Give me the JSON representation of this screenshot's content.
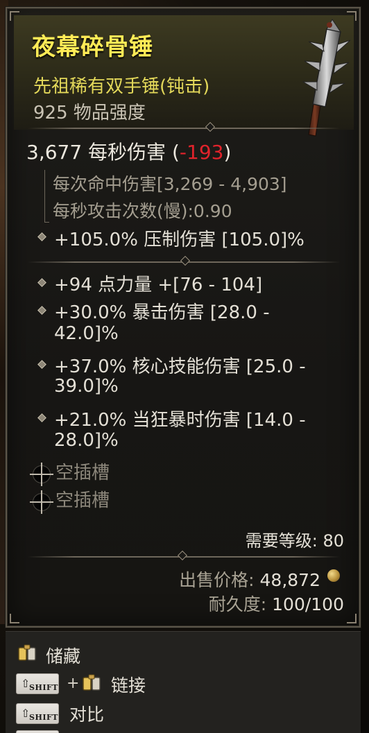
{
  "item": {
    "name": "夜幕碎骨锤",
    "type": "先祖稀有双手锤(钝击)",
    "power": "925 物品强度"
  },
  "stats": {
    "dps_value": "3,677 每秒伤害",
    "dps_delta_open": "(",
    "dps_delta": "-193",
    "dps_delta_close": ")",
    "damage_per_hit": "每次命中伤害[3,269 - 4,903]",
    "attack_speed": "每秒攻击次数(慢):0.90",
    "implicit": "+105.0% 压制伤害 [105.0]%"
  },
  "affixes": [
    {
      "line1": "+94 点力量 +[76 - 104]",
      "line2": ""
    },
    {
      "line1": "+30.0% 暴击伤害 [28.0 -",
      "line2": "42.0]%"
    },
    {
      "line1": "+37.0% 核心技能伤害 [25.0 -",
      "line2": "39.0]%"
    },
    {
      "line1": "+21.0% 当狂暴时伤害 [14.0 -",
      "line2": "28.0]%"
    }
  ],
  "sockets": [
    {
      "label": "空插槽"
    },
    {
      "label": "空插槽"
    }
  ],
  "requirements": {
    "level": "需要等级: 80"
  },
  "sell": {
    "label": "出售价格: ",
    "value": "48,872"
  },
  "durability": {
    "label": "耐久度: ",
    "value": "100/100"
  },
  "footer": {
    "stash_label": "储藏",
    "shift_key": "SHIFT",
    "plus": "+",
    "link_label": "链接",
    "compare_label": "对比"
  },
  "colors": {
    "legendary_title": "#ffeb56",
    "type_line": "#e3d85a",
    "negative": "#e0232b"
  }
}
